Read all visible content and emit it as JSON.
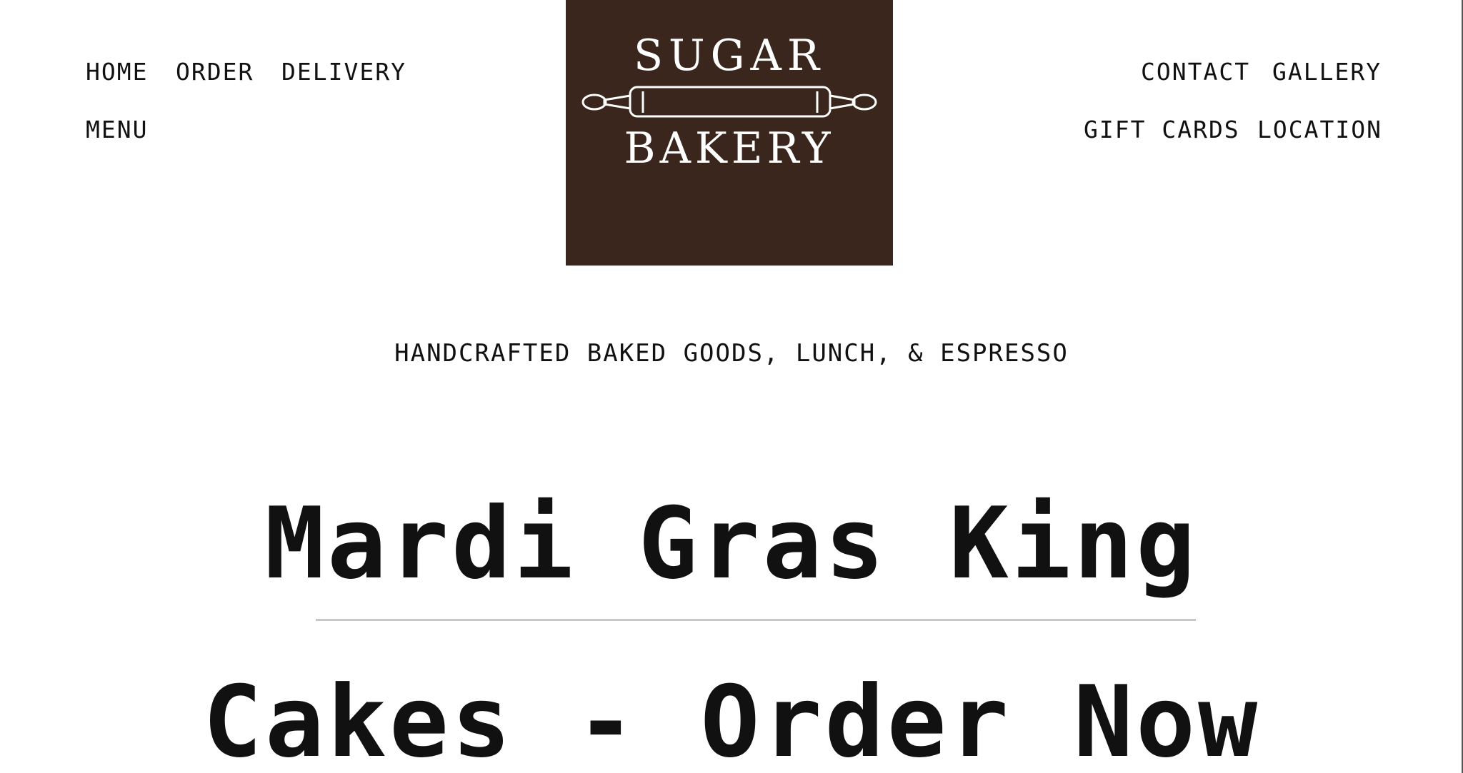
{
  "nav_left": {
    "home": "HOME",
    "order": "ORDER",
    "delivery": "DELIVERY",
    "menu": "MENU"
  },
  "nav_right": {
    "contact": "CONTACT",
    "gallery": "GALLERY",
    "gift_cards": "GIFT CARDS",
    "location": "LOCATION"
  },
  "logo": {
    "line1": "SUGAR",
    "line2": "BAKERY",
    "icon": "rolling-pin-icon",
    "background_color": "#3a261d",
    "text_color": "#ffffff"
  },
  "tagline": "HANDCRAFTED BAKED GOODS, LUNCH, & ESPRESSO",
  "headline": {
    "line1": "Mardi Gras King",
    "line2": "Cakes - Order Now"
  }
}
